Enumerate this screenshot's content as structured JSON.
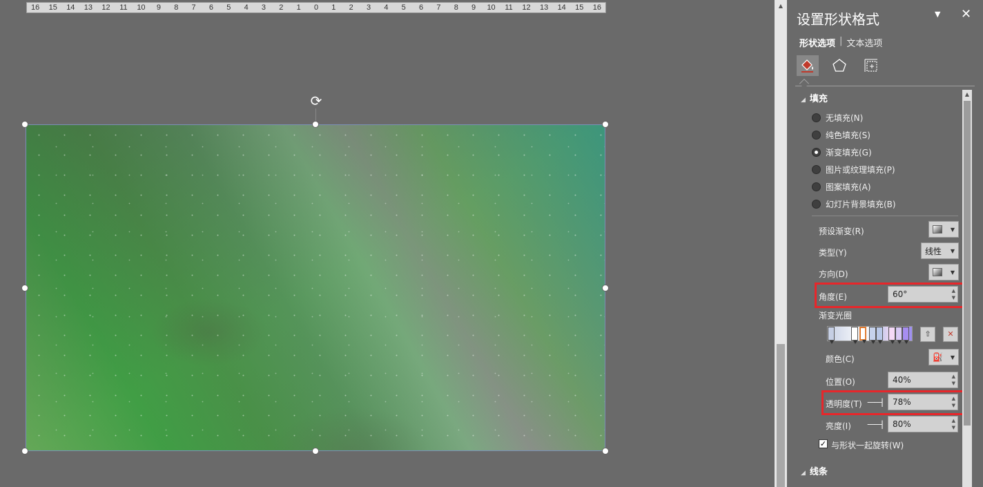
{
  "ruler": {
    "ticks": [
      "16",
      "15",
      "14",
      "13",
      "12",
      "11",
      "10",
      "9",
      "8",
      "7",
      "6",
      "5",
      "4",
      "3",
      "2",
      "1",
      "0",
      "1",
      "2",
      "3",
      "4",
      "5",
      "6",
      "7",
      "8",
      "9",
      "10",
      "11",
      "12",
      "13",
      "14",
      "15",
      "16"
    ]
  },
  "panel": {
    "title": "设置形状格式",
    "menu_glyph": "▼",
    "close_glyph": "✕",
    "tabs": {
      "shape": "形状选项",
      "text": "文本选项"
    },
    "fill_section": "填充",
    "line_section": "线条",
    "fill_options": [
      {
        "label": "无填充(N)",
        "selected": false
      },
      {
        "label": "纯色填充(S)",
        "selected": false
      },
      {
        "label": "渐变填充(G)",
        "selected": true
      },
      {
        "label": "图片或纹理填充(P)",
        "selected": false
      },
      {
        "label": "图案填充(A)",
        "selected": false
      },
      {
        "label": "幻灯片背景填充(B)",
        "selected": false
      }
    ],
    "preset_gradient_label": "预设渐变(R)",
    "type_label": "类型(Y)",
    "type_value": "线性",
    "direction_label": "方向(D)",
    "angle_label": "角度(E)",
    "angle_value": "60°",
    "gradient_stops_label": "渐变光圈",
    "color_label": "颜色(C)",
    "position_label": "位置(O)",
    "position_value": "40%",
    "transparency_label": "透明度(T)",
    "transparency_value": "78%",
    "brightness_label": "亮度(I)",
    "brightness_value": "80%",
    "rotate_with_shape_label": "与形状一起旋转(W)",
    "rotate_with_shape_checked": true
  },
  "icons": {
    "fill": "paint-bucket-icon",
    "effects": "pentagon-icon",
    "size": "size-layout-icon",
    "rotate": "rotate-handle-icon"
  },
  "colors": {
    "highlight": "#e8262a",
    "selected_stop": "#e07a2f"
  }
}
